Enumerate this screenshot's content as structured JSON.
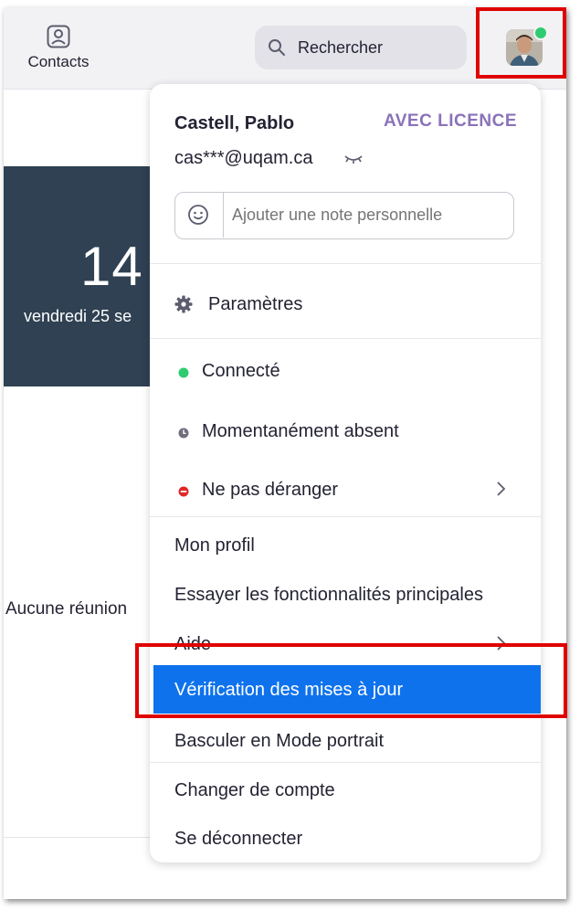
{
  "topbar": {
    "contacts_label": "Contacts",
    "search_placeholder": "Rechercher"
  },
  "background": {
    "clock": "14",
    "date": "vendredi 25 se",
    "no_meeting": "Aucune réunion"
  },
  "profile_menu": {
    "name": "Castell, Pablo",
    "license": "AVEC LICENCE",
    "email": "cas***@uqam.ca",
    "note_placeholder": "Ajouter une note personnelle",
    "settings": "Paramètres",
    "status": {
      "online": "Connecté",
      "away": "Momentanément absent",
      "dnd": "Ne pas déranger"
    },
    "items": {
      "profile": "Mon profil",
      "try_features": "Essayer les fonctionnalités principales",
      "help": "Aide",
      "check_updates": "Vérification des mises à jour",
      "portrait": "Basculer en Mode portrait",
      "switch_account": "Changer de compte",
      "sign_out": "Se déconnecter"
    }
  },
  "colors": {
    "accent": "#0e72ed",
    "online": "#2ecc71",
    "dnd": "#e02828",
    "license": "#8a72b8",
    "highlight": "#e00000"
  },
  "icons": [
    "contacts-icon",
    "search-icon",
    "eye-closed-icon",
    "emoji-icon",
    "gear-icon",
    "status-online-dot",
    "status-away-icon",
    "status-dnd-icon",
    "chevron-right-icon"
  ]
}
